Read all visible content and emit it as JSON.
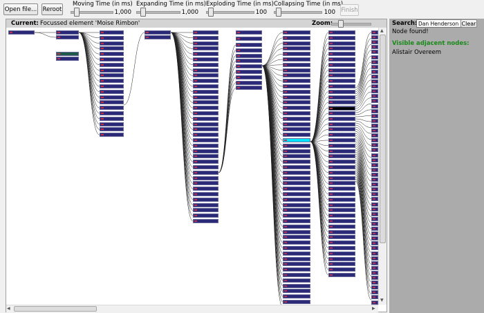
{
  "toolbar": {
    "open_label": "Open file...",
    "reroot_label": "Reroot",
    "finish_label": "Finish",
    "sliders": [
      {
        "label": "Moving Time (in ms)",
        "value": "1,000",
        "level": 0.1
      },
      {
        "label": "Expanding Time (in ms)",
        "value": "1,000",
        "level": 0.1
      },
      {
        "label": "Exploding Time (in ms)",
        "value": "100",
        "level": 0.05
      },
      {
        "label": "Collapsing Time (in ms)",
        "value": "100",
        "level": 0.05
      }
    ]
  },
  "panel": {
    "current_label": "Current:",
    "focus_text": "Focussed element 'Moise Rimbon'",
    "zoom_label": "Zoom:",
    "zoom_level": 0.2
  },
  "colors": {
    "node_fill": "#2a2a78",
    "node_marker": "#c0304a",
    "highlight_node": "#00e5ff",
    "found_text": "#1a8a1a",
    "sidebar_bg": "#ababab"
  },
  "side": {
    "search_label": "Search:",
    "search_value": "Dan Henderson",
    "clear_label": "Clear",
    "status_text": "Node found!",
    "adjacent_heading": "Visible adjacent nodes:",
    "adjacent_nodes": [
      "Alistair Overeem"
    ]
  }
}
